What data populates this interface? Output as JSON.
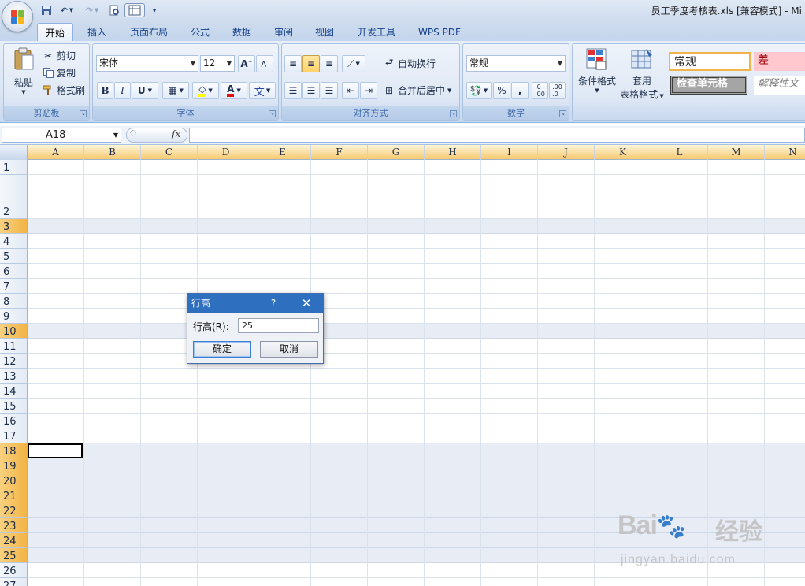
{
  "window": {
    "title": "员工季度考核表.xls  [兼容模式] - Mi"
  },
  "tabs": [
    "开始",
    "插入",
    "页面布局",
    "公式",
    "数据",
    "审阅",
    "视图",
    "开发工具",
    "WPS PDF"
  ],
  "ribbon": {
    "clipboard": {
      "paste": "粘贴",
      "cut": "剪切",
      "copy": "复制",
      "format_painter": "格式刷",
      "label": "剪贴板"
    },
    "font": {
      "name": "宋体",
      "size": "12",
      "label": "字体"
    },
    "alignment": {
      "wrap": "自动换行",
      "merge": "合并后居中",
      "label": "对齐方式"
    },
    "number": {
      "format": "常规",
      "label": "数字"
    },
    "styles": {
      "conditional": "条件格式",
      "table_line1": "套用",
      "table_line2": "表格格式",
      "normal": "常规",
      "bad": "差",
      "check": "检查单元格",
      "explain": "解释性文"
    }
  },
  "formula_bar": {
    "name_box": "A18",
    "fx": "fx"
  },
  "columns": [
    "A",
    "B",
    "C",
    "D",
    "E",
    "F",
    "G",
    "H",
    "I",
    "J",
    "K",
    "L",
    "M",
    "N"
  ],
  "rows": [
    "1",
    "2",
    "3",
    "4",
    "5",
    "6",
    "7",
    "8",
    "9",
    "10",
    "11",
    "12",
    "13",
    "14",
    "15",
    "16",
    "17",
    "18",
    "19",
    "20",
    "21",
    "22",
    "23",
    "24",
    "25",
    "26",
    "27"
  ],
  "dialog": {
    "title": "行高",
    "help": "?",
    "label": "行高(R):",
    "value": "25",
    "ok": "确定",
    "cancel": "取消"
  },
  "watermark": {
    "brand": "Bai",
    "brand2": "经验",
    "url": "jingyan.baidu.com"
  }
}
